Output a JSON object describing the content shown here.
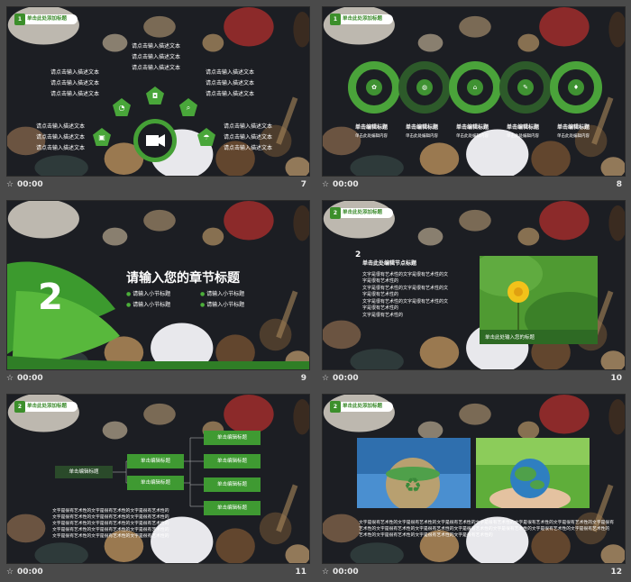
{
  "footer": {
    "time": "00:00"
  },
  "pill_label": "单击此处添加标题",
  "slides": [
    {
      "number": "7",
      "texts": [
        "请点击输入描述文本",
        "请点击输入描述文本",
        "请点击输入描述文本",
        "请点击输入描述文本",
        "请点击输入描述文本",
        "请点击输入描述文本",
        "请点击输入描述文本",
        "请点击输入描述文本",
        "请点击输入描述文本",
        "请点击输入描述文本",
        "请点击输入描述文本",
        "请点击输入描述文本",
        "请点击输入描述文本",
        "请点击输入描述文本",
        "请点击输入描述文本"
      ]
    },
    {
      "number": "8",
      "items": [
        {
          "title": "单击编辑标题",
          "desc": "单击此处编辑内容"
        },
        {
          "title": "单击编辑标题",
          "desc": "单击此处编辑内容"
        },
        {
          "title": "单击编辑标题",
          "desc": "单击此处编辑内容"
        },
        {
          "title": "单击编辑标题",
          "desc": "单击此处编辑内容"
        },
        {
          "title": "单击编辑标题",
          "desc": "单击此处编辑内容"
        }
      ]
    },
    {
      "number": "9",
      "section_number": "2",
      "section_title": "请输入您的章节标题",
      "bullets": [
        "请输入小节标题",
        "请输入小节标题",
        "请输入小节标题",
        "请输入小节标题"
      ]
    },
    {
      "number": "10",
      "digit": "2",
      "heading": "单击此处编辑节点标题",
      "body": [
        "文字是很有艺术性的文字是很有艺术性的文",
        "字是很有艺术性的",
        "文字是很有艺术性的文字是很有艺术性的文",
        "字是很有艺术性的",
        "文字是很有艺术性的文字是很有艺术性的文",
        "字是很有艺术性的",
        "文字是很有艺术性的"
      ],
      "caption": "单击此处输入您的标题"
    },
    {
      "number": "11",
      "root": "单击编辑标题",
      "mid": [
        "单击编辑标题",
        "单击编辑标题"
      ],
      "leaves": [
        "单击编辑标题",
        "单击编辑标题",
        "单击编辑标题",
        "单击编辑标题"
      ],
      "body": [
        "文字是很有艺术性的文字是很有艺术性的文字是很有艺术性的",
        "文字是很有艺术性的文字是很有艺术性的文字是很有艺术性的",
        "文字是很有艺术性的文字是很有艺术性的文字是很有艺术性的",
        "文字是很有艺术性的文字是很有艺术性的文字是很有艺术性的",
        "文字是很有艺术性的文字是很有艺术性的文字是很有艺术性的"
      ]
    },
    {
      "number": "12",
      "body": [
        "文字是很有艺术性的文字是很有艺术性的文字是很有艺术性的文字是很有艺术性的文字是很有艺术性的文字是很有艺术性的文字是很有",
        "艺术性的文字是很有艺术性的文字是很有艺术性的文字是很有艺术性的文字是很有艺术性的文字是很有艺术性的文字是很有艺术性的",
        "艺术性的文字是很有艺术性的文字是很有艺术性的文字是很有艺术性的"
      ]
    }
  ]
}
